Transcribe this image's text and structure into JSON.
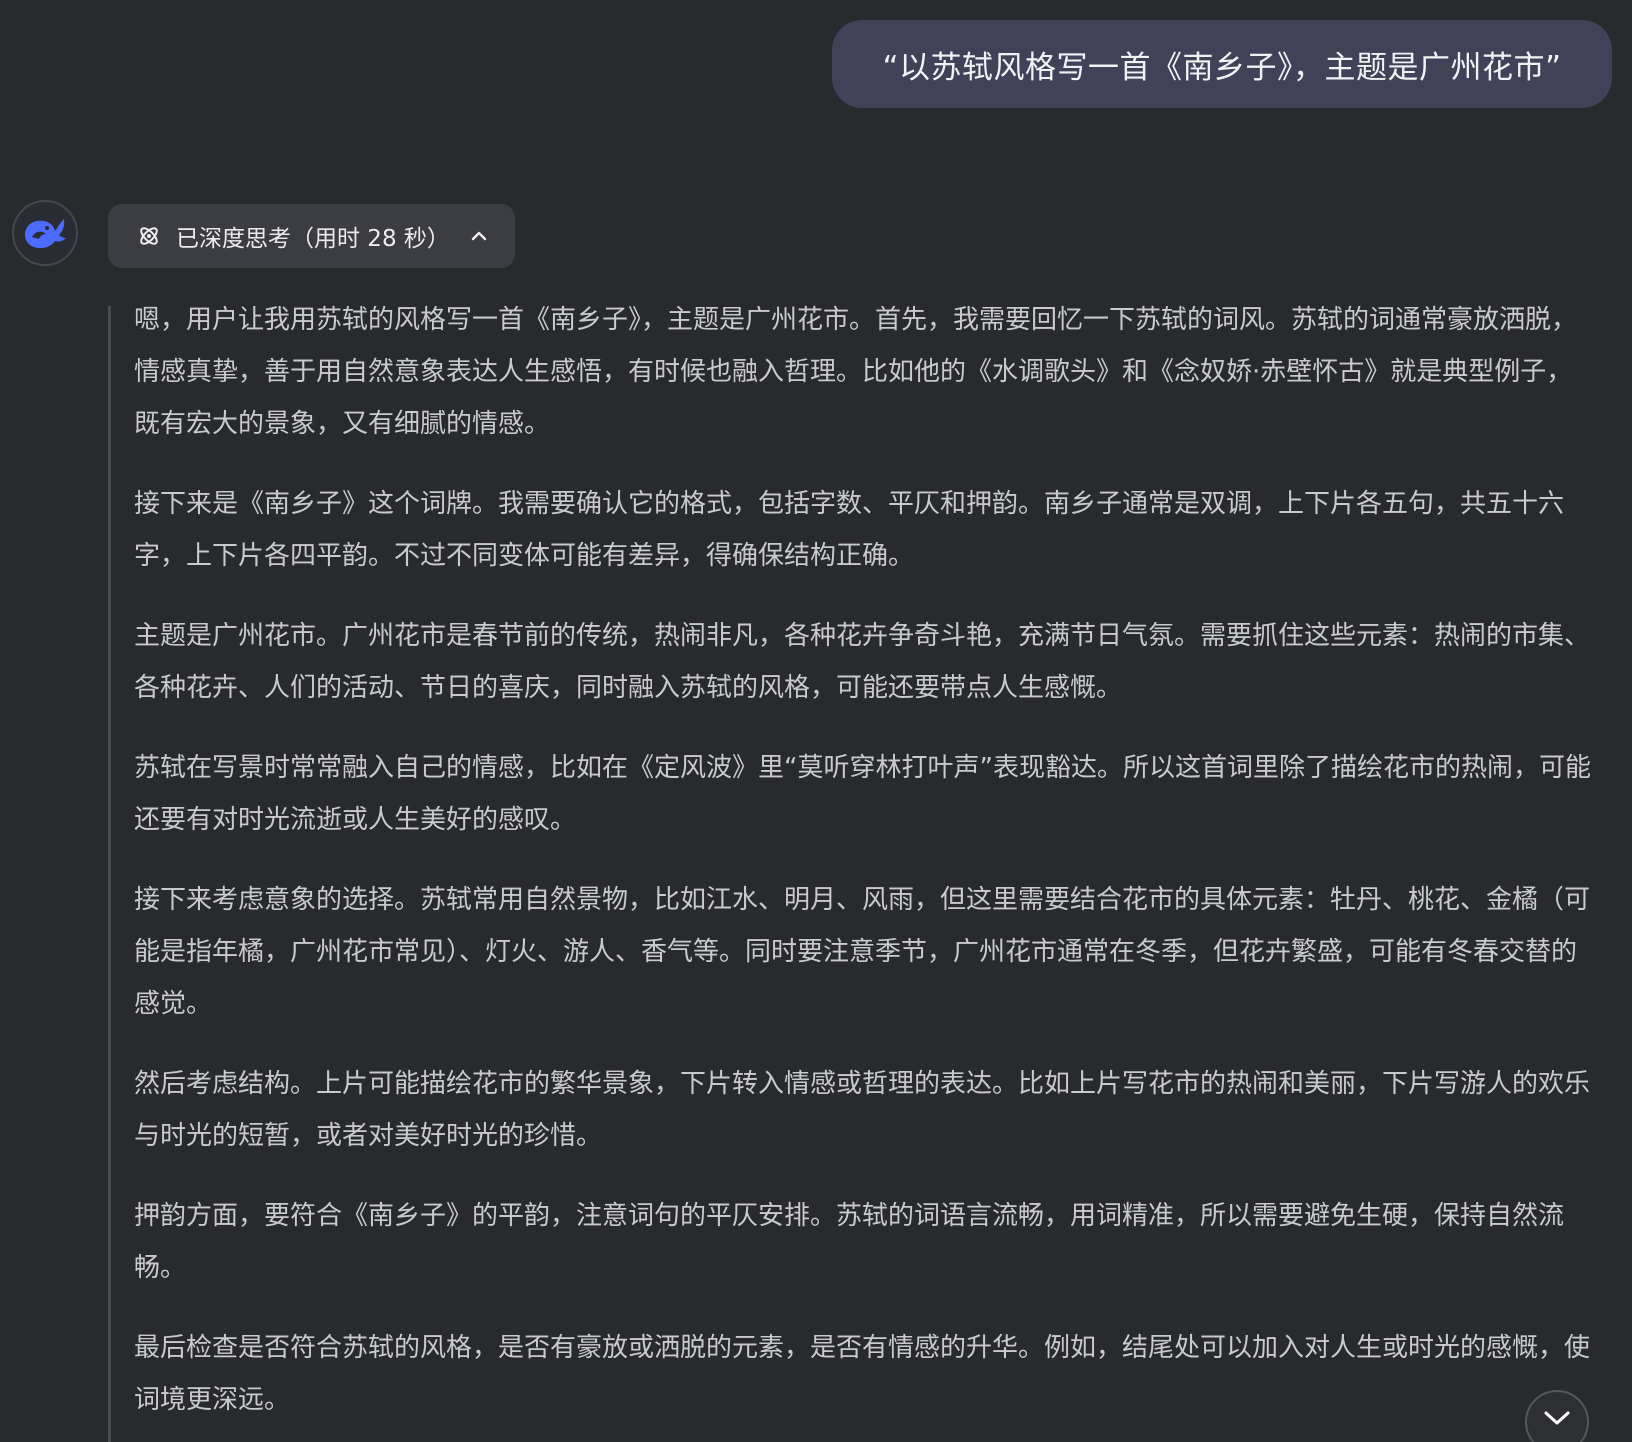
{
  "user_message": "“以苏轼风格写一首《南乡子》，主题是广州花市”",
  "thinking": {
    "label": "已深度思考（用时 28 秒）",
    "icon": "atom-icon",
    "toggle_icon": "chevron-up-icon"
  },
  "assistant": {
    "avatar_icon": "whale-logo-icon",
    "avatar_color": "#4d6bfe"
  },
  "thought_paragraphs": [
    "嗯，用户让我用苏轼的风格写一首《南乡子》，主题是广州花市。首先，我需要回忆一下苏轼的词风。苏轼的词通常豪放洒脱，情感真挚，善于用自然意象表达人生感悟，有时候也融入哲理。比如他的《水调歌头》和《念奴娇·赤壁怀古》就是典型例子，既有宏大的景象，又有细腻的情感。",
    "接下来是《南乡子》这个词牌。我需要确认它的格式，包括字数、平仄和押韵。南乡子通常是双调，上下片各五句，共五十六字，上下片各四平韵。不过不同变体可能有差异，得确保结构正确。",
    "主题是广州花市。广州花市是春节前的传统，热闹非凡，各种花卉争奇斗艳，充满节日气氛。需要抓住这些元素：热闹的市集、各种花卉、人们的活动、节日的喜庆，同时融入苏轼的风格，可能还要带点人生感慨。",
    "苏轼在写景时常常融入自己的情感，比如在《定风波》里“莫听穿林打叶声”表现豁达。所以这首词里除了描绘花市的热闹，可能还要有对时光流逝或人生美好的感叹。",
    "接下来考虑意象的选择。苏轼常用自然景物，比如江水、明月、风雨，但这里需要结合花市的具体元素：牡丹、桃花、金橘（可能是指年橘，广州花市常见）、灯火、游人、香气等。同时要注意季节，广州花市通常在冬季，但花卉繁盛，可能有冬春交替的感觉。",
    "然后考虑结构。上片可能描绘花市的繁华景象，下片转入情感或哲理的表达。比如上片写花市的热闹和美丽，下片写游人的欢乐与时光的短暂，或者对美好时光的珍惜。",
    "押韵方面，要符合《南乡子》的平韵，注意词句的平仄安排。苏轼的词语言流畅，用词精准，所以需要避免生硬，保持自然流畅。",
    "最后检查是否符合苏轼的风格，是否有豪放或洒脱的元素，是否有情感的升华。例如，结尾处可以加入对人生或时光的感慨，使词境更深远。"
  ],
  "scroll_button": {
    "icon": "chevron-down-icon"
  }
}
